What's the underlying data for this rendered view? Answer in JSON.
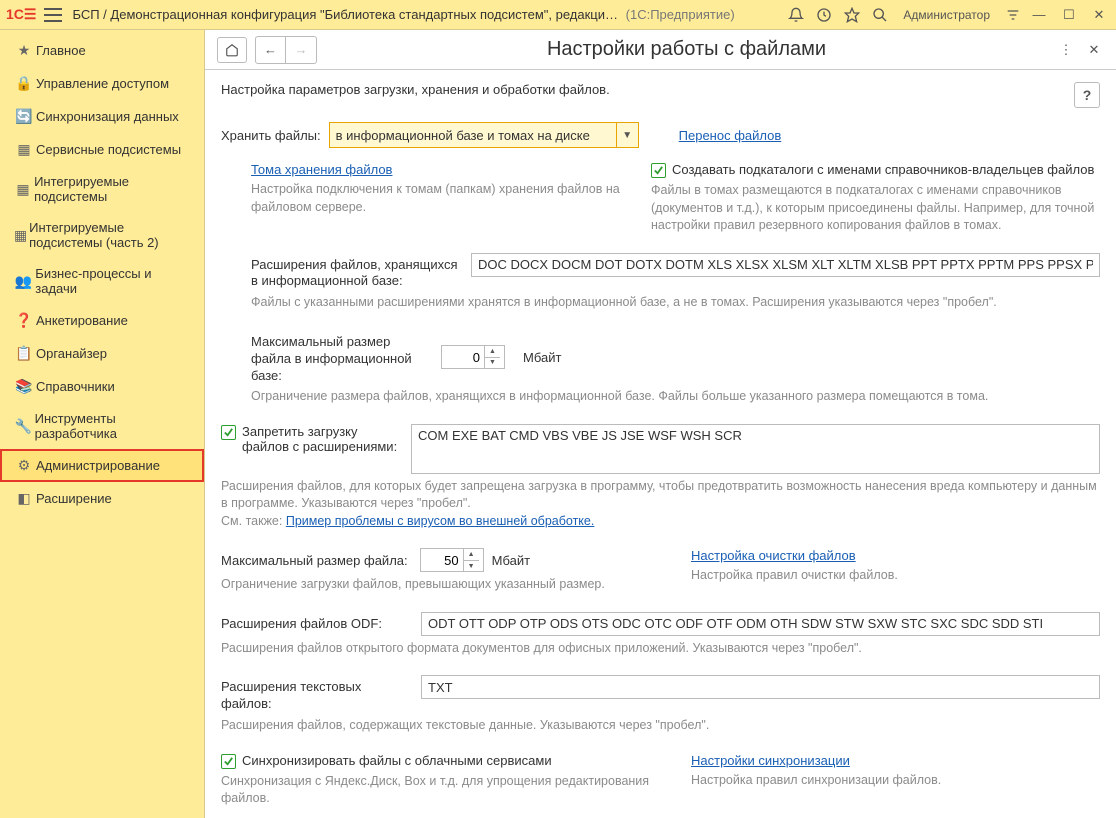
{
  "titlebar": {
    "app_title": "БСП / Демонстрационная конфигурация \"Библиотека стандартных подсистем\", редакци…",
    "app_title_secondary": "(1С:Предприятие)",
    "user_label": "Администратор"
  },
  "sidebar": {
    "items": [
      {
        "icon": "★",
        "label": "Главное"
      },
      {
        "icon": "🔒",
        "label": "Управление доступом"
      },
      {
        "icon": "🔄",
        "label": "Синхронизация данных"
      },
      {
        "icon": "⋯",
        "label": "Сервисные подсистемы"
      },
      {
        "icon": "⋯",
        "label": "Интегрируемые подсистемы"
      },
      {
        "icon": "⋯",
        "label": "Интегрируемые подсистемы (часть 2)"
      },
      {
        "icon": "👥",
        "label": "Бизнес-процессы и задачи"
      },
      {
        "icon": "❓",
        "label": "Анкетирование"
      },
      {
        "icon": "📋",
        "label": "Органайзер"
      },
      {
        "icon": "📚",
        "label": "Справочники"
      },
      {
        "icon": "🔧",
        "label": "Инструменты разработчика"
      },
      {
        "icon": "⚙",
        "label": "Администрирование"
      },
      {
        "icon": "◧",
        "label": "Расширение"
      }
    ]
  },
  "page": {
    "title": "Настройки работы с файлами",
    "subtitle": "Настройка параметров загрузки, хранения и обработки файлов.",
    "store_label": "Хранить файлы:",
    "store_value": "в информационной базе и томах на диске",
    "transfer_link": "Перенос файлов",
    "volumes_link": "Тома хранения файлов",
    "volumes_hint": "Настройка подключения к томам (папкам) хранения файлов на файловом сервере.",
    "subfolders_checkbox": "Создавать подкаталоги с именами справочников-владельцев файлов",
    "subfolders_hint": "Файлы в томах размещаются в подкаталогах с именами справочников (документов и т.д.), к которым присоединены файлы. Например, для точной настройки правил резервного копирования файлов в томах.",
    "ext_label": "Расширения файлов, хранящихся в информационной базе:",
    "ext_value": "DOC DOCX DOCM DOT DOTX DOTM XLS XLSX XLSM XLT XLTM XLSB PPT PPTX PPTM PPS PPSX PF",
    "ext_hint": "Файлы с указанными расширениями хранятся в информационной базе, а не в томах. Расширения указываются через \"пробел\".",
    "maxsize_ib_label": "Максимальный размер файла в информационной базе:",
    "maxsize_ib_value": "0",
    "unit_mb": "Мбайт",
    "maxsize_ib_hint": "Ограничение размера файлов, хранящихся в информационной базе. Файлы больше указанного размера помещаются в тома.",
    "deny_checkbox": "Запретить загрузку файлов с расширениями:",
    "deny_value": "COM EXE BAT CMD VBS VBE JS JSE WSF WSH SCR",
    "deny_hint": "Расширения файлов, для которых будет запрещена загрузка в программу, чтобы предотвратить возможность нанесения вреда компьютеру и данным в программе. Указываются через \"пробел\".",
    "see_also": "См. также: ",
    "virus_link": "Пример проблемы с вирусом во внешней  обработке.",
    "maxsize_label": "Максимальный размер файла:",
    "maxsize_value": "50",
    "maxsize_hint": "Ограничение загрузки файлов, превышающих указанный размер.",
    "cleanup_link": "Настройка очистки файлов",
    "cleanup_hint": "Настройка правил очистки файлов.",
    "odf_label": "Расширения файлов ODF:",
    "odf_value": "ODT OTT ODP OTP ODS OTS ODC OTC ODF OTF ODM OTH SDW STW SXW STC SXC SDC SDD STI",
    "odf_hint": "Расширения файлов открытого формата документов для офисных приложений. Указываются через \"пробел\".",
    "txt_label": "Расширения текстовых файлов:",
    "txt_value": "TXT",
    "txt_hint": "Расширения файлов, содержащих текстовые данные. Указываются через \"пробел\".",
    "sync_checkbox": "Синхронизировать файлы с облачными сервисами",
    "sync_hint": "Синхронизация с Яндекс.Диск, Box и т.д. для упрощения редактирования файлов.",
    "sync_settings_link": "Настройки синхронизации",
    "sync_settings_hint": "Настройка правил синхронизации файлов."
  }
}
